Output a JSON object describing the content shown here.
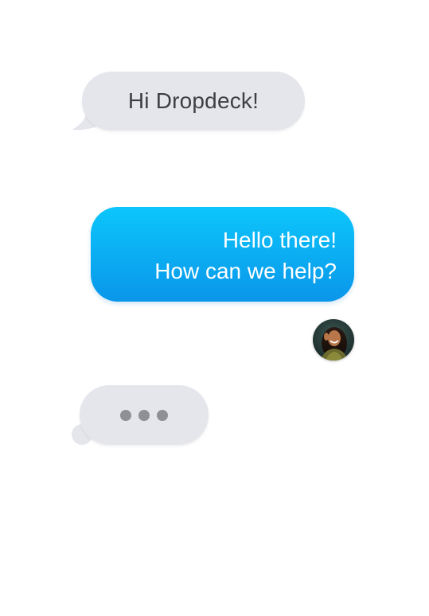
{
  "messages": {
    "incoming_text": "Hi Dropdeck!",
    "outgoing_lines": [
      "Hello there!",
      "How can we help?"
    ]
  },
  "avatar": {
    "icon": "user-avatar-photo"
  },
  "typing_indicator": {
    "dot_count": 3
  },
  "colors": {
    "incoming_bubble": "#e5e6ec",
    "incoming_text": "#3e3f45",
    "outgoing_gradient_top": "#0cc6fb",
    "outgoing_gradient_bottom": "#0a96ea",
    "outgoing_text": "#ffffff",
    "typing_dot": "#8f9095"
  }
}
